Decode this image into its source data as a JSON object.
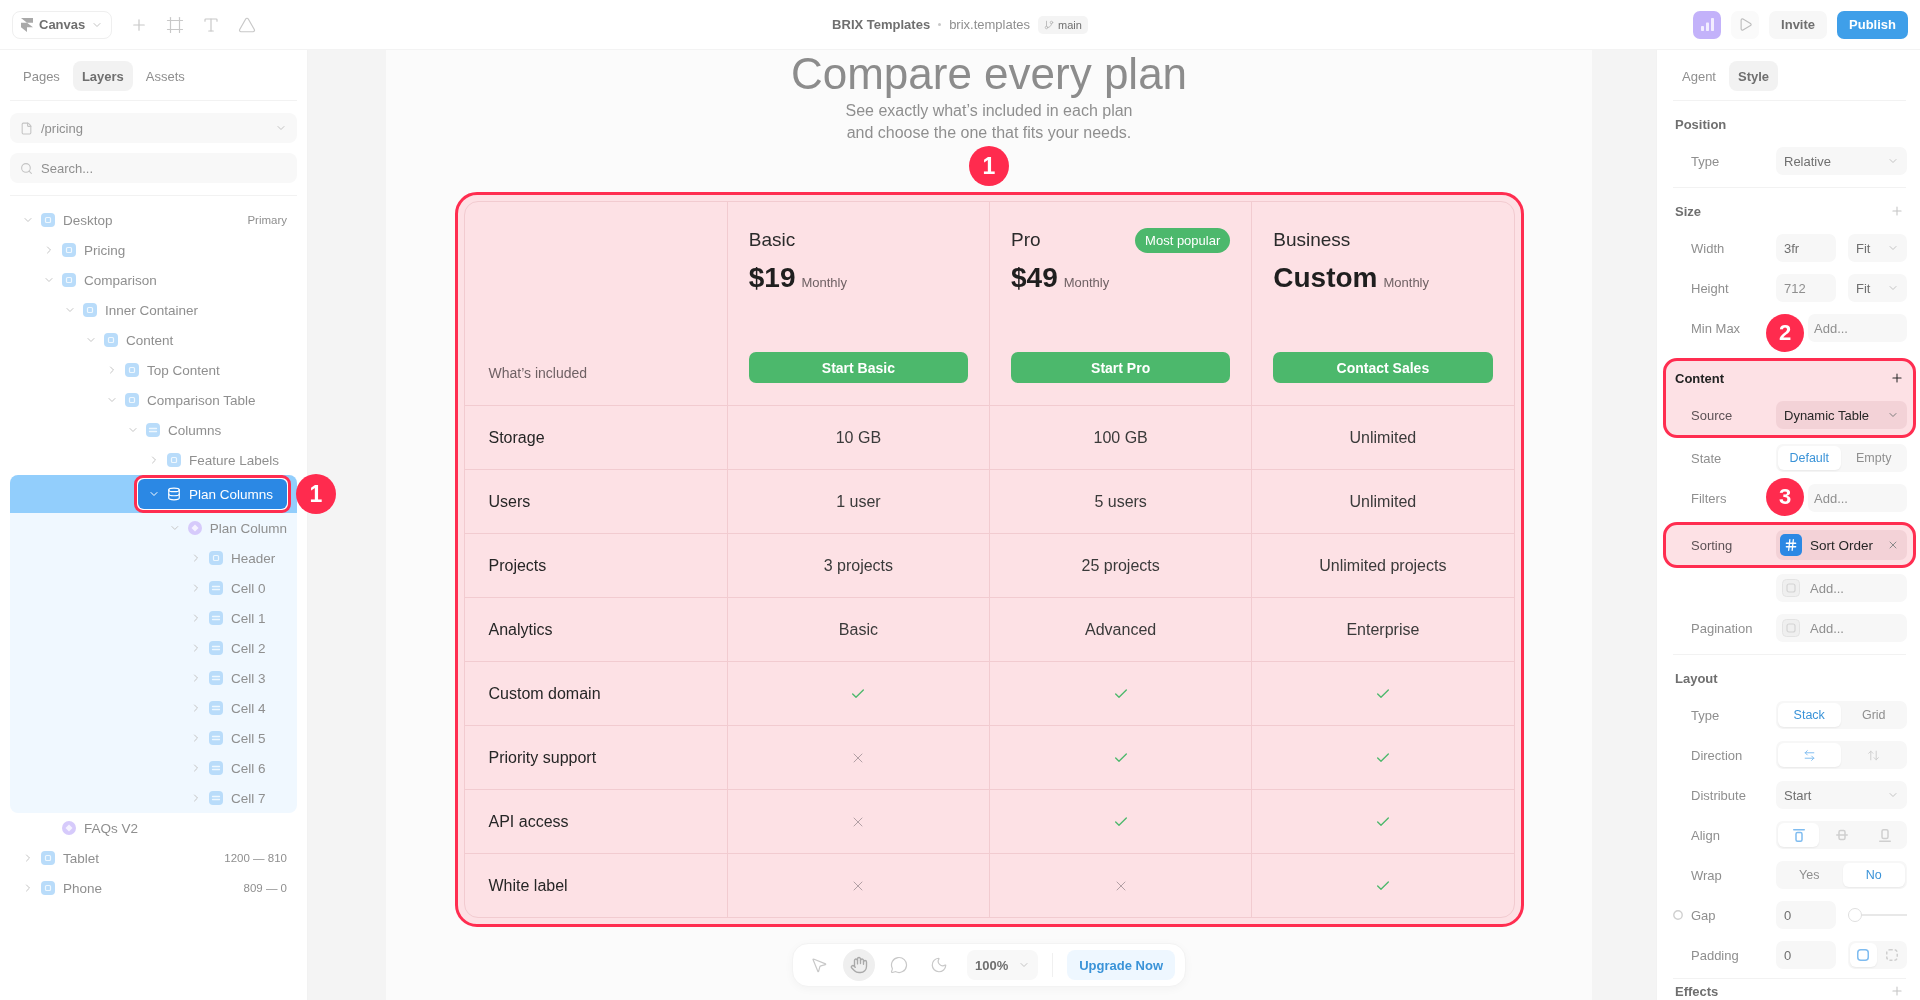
{
  "top_bar": {
    "menu": "Canvas",
    "project": {
      "name": "BRIX Templates",
      "domain": "brix.templates",
      "branch": "main"
    },
    "invite": "Invite",
    "publish": "Publish"
  },
  "left_panel": {
    "tabs": [
      {
        "label": "Pages",
        "selected": false
      },
      {
        "label": "Layers",
        "selected": true
      },
      {
        "label": "Assets",
        "selected": false
      }
    ],
    "page": "/pricing",
    "search": {
      "placeholder": "Search..."
    },
    "layers": [
      {
        "name": "Desktop",
        "kind": "frame",
        "meta": "Primary",
        "expanded": true,
        "selected": false,
        "children": [
          {
            "name": "Pricing",
            "kind": "frame",
            "expanded": false,
            "selected": false
          },
          {
            "name": "Comparison",
            "kind": "frame",
            "expanded": true,
            "selected": false,
            "children": [
              {
                "name": "Inner Container",
                "kind": "frame",
                "expanded": true,
                "selected": false,
                "children": [
                  {
                    "name": "Content",
                    "kind": "frame",
                    "expanded": true,
                    "selected": false,
                    "children": [
                      {
                        "name": "Top Content",
                        "kind": "frame",
                        "expanded": false,
                        "selected": false
                      },
                      {
                        "name": "Comparison Table",
                        "kind": "frame",
                        "expanded": true,
                        "selected": false,
                        "children": [
                          {
                            "name": "Columns",
                            "kind": "stack",
                            "expanded": true,
                            "selected": false,
                            "children": [
                              {
                                "name": "Feature Labels",
                                "kind": "frame",
                                "expanded": false,
                                "selected": false
                              },
                              {
                                "name": "Plan Columns",
                                "kind": "collection",
                                "expanded": true,
                                "selected": true,
                                "callout": "1",
                                "children": [
                                  {
                                    "name": "Plan Column",
                                    "kind": "component",
                                    "expanded": true,
                                    "selected": false,
                                    "children": [
                                      {
                                        "name": "Header",
                                        "kind": "frame",
                                        "expanded": false,
                                        "selected": false
                                      },
                                      {
                                        "name": "Cell 0",
                                        "kind": "stack",
                                        "expanded": false,
                                        "selected": false
                                      },
                                      {
                                        "name": "Cell 1",
                                        "kind": "stack",
                                        "expanded": false,
                                        "selected": false
                                      },
                                      {
                                        "name": "Cell 2",
                                        "kind": "stack",
                                        "expanded": false,
                                        "selected": false
                                      },
                                      {
                                        "name": "Cell 3",
                                        "kind": "stack",
                                        "expanded": false,
                                        "selected": false
                                      },
                                      {
                                        "name": "Cell 4",
                                        "kind": "stack",
                                        "expanded": false,
                                        "selected": false
                                      },
                                      {
                                        "name": "Cell 5",
                                        "kind": "stack",
                                        "expanded": false,
                                        "selected": false
                                      },
                                      {
                                        "name": "Cell 6",
                                        "kind": "stack",
                                        "expanded": false,
                                        "selected": false
                                      },
                                      {
                                        "name": "Cell 7",
                                        "kind": "stack",
                                        "expanded": false,
                                        "selected": false
                                      }
                                    ]
                                  }
                                ]
                              }
                            ]
                          }
                        ]
                      }
                    ]
                  }
                ]
              }
            ]
          },
          {
            "name": "FAQs V2",
            "kind": "component",
            "selected": false
          }
        ]
      },
      {
        "name": "Tablet",
        "kind": "frame",
        "meta": "1200 — 810",
        "expanded": false,
        "selected": false
      },
      {
        "name": "Phone",
        "kind": "frame",
        "meta": "809 — 0",
        "expanded": false,
        "selected": false
      }
    ]
  },
  "canvas": {
    "heading": "Compare every plan",
    "subtitle": "See exactly what’s included in each plan and choose the one that fits your needs.",
    "comparison_table": {
      "callout": "1",
      "corner_label": "What’s included",
      "plans": [
        {
          "name": "Basic",
          "price": "$19",
          "period": "Monthly",
          "button": "Start Basic"
        },
        {
          "name": "Pro",
          "price": "$49",
          "period": "Monthly",
          "badge": "Most popular",
          "button": "Start Pro"
        },
        {
          "name": "Business",
          "price": "Custom",
          "period": "Monthly",
          "button": "Contact Sales"
        }
      ],
      "rows": [
        {
          "feature": "Storage",
          "cells": [
            {
              "kind": "text",
              "text": "10 GB"
            },
            {
              "kind": "text",
              "text": "100 GB"
            },
            {
              "kind": "text",
              "text": "Unlimited"
            }
          ]
        },
        {
          "feature": "Users",
          "cells": [
            {
              "kind": "text",
              "text": "1 user"
            },
            {
              "kind": "text",
              "text": "5 users"
            },
            {
              "kind": "text",
              "text": "Unlimited"
            }
          ]
        },
        {
          "feature": "Projects",
          "cells": [
            {
              "kind": "text",
              "text": "3 projects"
            },
            {
              "kind": "text",
              "text": "25 projects"
            },
            {
              "kind": "text",
              "text": "Unlimited projects"
            }
          ]
        },
        {
          "feature": "Analytics",
          "cells": [
            {
              "kind": "text",
              "text": "Basic"
            },
            {
              "kind": "text",
              "text": "Advanced"
            },
            {
              "kind": "text",
              "text": "Enterprise"
            }
          ]
        },
        {
          "feature": "Custom domain",
          "cells": [
            {
              "kind": "check"
            },
            {
              "kind": "check"
            },
            {
              "kind": "check"
            }
          ]
        },
        {
          "feature": "Priority support",
          "cells": [
            {
              "kind": "cross"
            },
            {
              "kind": "check"
            },
            {
              "kind": "check"
            }
          ]
        },
        {
          "feature": "API access",
          "cells": [
            {
              "kind": "cross"
            },
            {
              "kind": "check"
            },
            {
              "kind": "check"
            }
          ]
        },
        {
          "feature": "White label",
          "cells": [
            {
              "kind": "cross"
            },
            {
              "kind": "cross"
            },
            {
              "kind": "check"
            }
          ]
        }
      ]
    },
    "bottom_toolbar": {
      "tools": [
        {
          "kind": "pointer",
          "selected": false
        },
        {
          "kind": "hand",
          "selected": true
        },
        {
          "kind": "comment",
          "selected": false
        },
        {
          "kind": "theme",
          "selected": false
        }
      ],
      "zoom": "100%",
      "upgrade": "Upgrade Now"
    }
  },
  "right_panel": {
    "tabs": [
      {
        "label": "Agent",
        "selected": false
      },
      {
        "label": "Style",
        "selected": true
      }
    ],
    "sections": [
      {
        "title": "Position",
        "rows": [
          {
            "label": "Type",
            "kind": "select",
            "value": "Relative"
          }
        ]
      },
      {
        "title": "Size",
        "addable": true,
        "rows": [
          {
            "label": "Width",
            "kind": "pair",
            "value": "3fr",
            "unit": "Fit"
          },
          {
            "label": "Height",
            "kind": "pair",
            "placeholder": "712",
            "unit": "Fit"
          },
          {
            "label": "Min Max",
            "kind": "add",
            "placeholder": "Add..."
          }
        ]
      },
      {
        "title": "Content",
        "addable": true,
        "callout": "2",
        "rows": [
          {
            "label": "Source",
            "kind": "select",
            "value": "Dynamic Table"
          }
        ]
      },
      {
        "rows": [
          {
            "label": "State",
            "kind": "segmented",
            "options": [
              {
                "label": "Default",
                "selected": true
              },
              {
                "label": "Empty",
                "selected": false
              }
            ]
          },
          {
            "label": "Filters",
            "kind": "add",
            "placeholder": "Add..."
          },
          {
            "label": "Sorting",
            "kind": "chip",
            "value": "Sort Order",
            "callout": "3"
          },
          {
            "kind": "picker",
            "placeholder": "Add..."
          },
          {
            "label": "Pagination",
            "kind": "picker",
            "placeholder": "Add..."
          }
        ]
      },
      {
        "title": "Layout",
        "rows": [
          {
            "label": "Type",
            "kind": "segmented",
            "options": [
              {
                "label": "Stack",
                "selected": true
              },
              {
                "label": "Grid",
                "selected": false
              }
            ]
          },
          {
            "label": "Direction",
            "kind": "icons",
            "options": [
              {
                "kind": "horizontal",
                "selected": true
              },
              {
                "kind": "vertical",
                "selected": false
              }
            ]
          },
          {
            "label": "Distribute",
            "kind": "select",
            "value": "Start"
          },
          {
            "label": "Align",
            "kind": "icons",
            "options": [
              {
                "kind": "top",
                "selected": true
              },
              {
                "kind": "middle",
                "selected": false
              },
              {
                "kind": "bottom",
                "selected": false
              }
            ]
          },
          {
            "label": "Wrap",
            "kind": "segmented",
            "options": [
              {
                "label": "Yes",
                "selected": false
              },
              {
                "label": "No",
                "selected": true
              }
            ]
          },
          {
            "label": "Gap",
            "kind": "slider",
            "value": "0",
            "level": 0
          },
          {
            "label": "Padding",
            "kind": "padding",
            "value": "0",
            "options": [
              {
                "kind": "uniform",
                "selected": true
              },
              {
                "kind": "individual",
                "selected": false
              }
            ]
          }
        ]
      },
      {
        "title": "Effects",
        "addable": true
      }
    ]
  }
}
